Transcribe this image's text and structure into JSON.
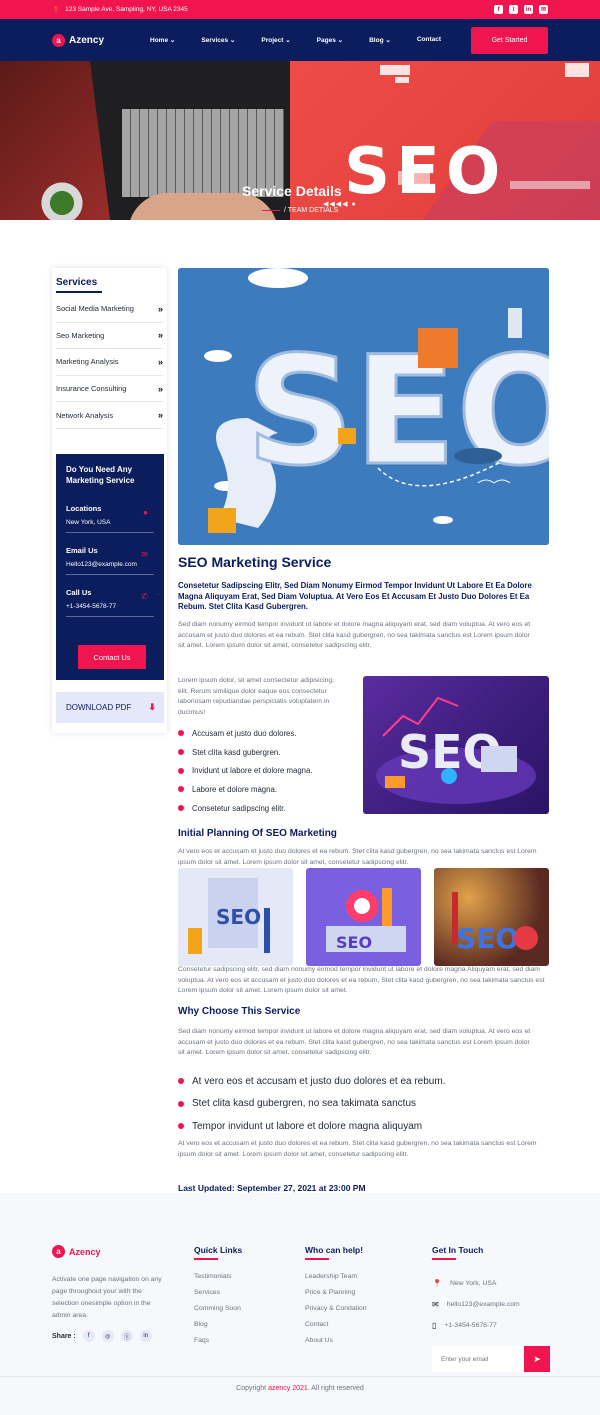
{
  "topbar": {
    "address": "123 Sample Ave, Sampling, NY, USA 2345"
  },
  "nav": {
    "logo": "Azency",
    "logo_mark": "a",
    "items": [
      "Home",
      "Services",
      "Project",
      "Pages",
      "Blog",
      "Contact"
    ],
    "cta": "Get Started"
  },
  "hero": {
    "title": "Service Details",
    "breadcrumb": "/ TEAM DETIALS",
    "seo_text": "SEO",
    "arrows": "◀◀◀◀ ●"
  },
  "sidebar": {
    "title": "Services",
    "items": [
      "Social Media Marketing",
      "Seo Marketing",
      "Marketing Analysis",
      "Insurance Consulting",
      "Network Analysis"
    ],
    "chevron": "»",
    "contact": {
      "title": "Do You Need Any Marketing Service",
      "locations_label": "Locations",
      "locations_value": "New York, USA",
      "email_label": "Email Us",
      "email_value": "Hello123@example.com",
      "call_label": "Call Us",
      "call_value": "+1-3454-5678-77",
      "button": "Contact Us"
    },
    "download": "DOWNLOAD PDF"
  },
  "main": {
    "seo_image_text": "SEO",
    "title": "SEO Marketing Service",
    "lead": "Consetetur Sadipscing Elitr, Sed Diam Nonumy Eirmod Tempor Invidunt Ut Labore Et Ea Dolore Magna Aliquyam Erat, Sed Diam Voluptua. At Vero Eos Et Accusam Et Justo Duo Dolores Et Ea Rebum. Stet Clita Kasd Gubergren.",
    "p1": "Sed diam nonumy eirmod tempor invidunt ut labore et dolore magna aliquyam erat, sed diam voluptua. At vero eos et accusam et justo duo dolores et ea rebum. Stet clita kasd gubergren, no sea takimata sanctus est Lorem ipsum dolor sit amet. Lorem ipsum dolor sit amet, consetetur sadipscing elitr.",
    "p2": "Lorem ipsum dolor, sit amet consectetur adipisicing, elit. Rerum similique dolor eaque eos consectetur laboriosam repudiandae perspiciatis voluptatem in ducimus!",
    "bullets": [
      "Accusam et justo duo dolores.",
      "Stet clita kasd gubergren.",
      "Invidunt ut labore et dolore magna.",
      "Labore et dolore magna.",
      "Consetetur sadipscing elitr."
    ],
    "h_planning": "Initial Planning Of SEO Marketing",
    "p3": "At vero eos et accusam et justo duo dolores et ea rebum. Stet clita kasd gubergren, no sea takimata sanctus est Lorem ipsum dolor sit amet. Lorem ipsum dolor sit amet, consetetur sadipscing elitr.",
    "p4": "Consetetur sadipscing elitr, sed diam nonumy eirmod tempor invidunt ut labore et dolore magna Aliquyam erat, sed diam voluptua. At vero eos et accusam et justo duo dolores et ea rebum, Stet clita kasd gubergren, no sea takimata sanctus est Lorem ipsum dolor sit amet. Lorem ipsum dolor sit amet.",
    "h_why": "Why Choose This Service",
    "p5": "Sed diam nonumy eirmod tempor invidunt ut labore et dolore magna aliquyam erat, sed diam voluptua. At vero eos et accusam et justo duo dolores et ea rebum. Stet clita kasd gubergren, no sea takimata sanctus est Lorem ipsum dolor sit amet. Lorem ipsum dolor sit amet, consetetur sadipscing elitr.",
    "why_bullets": [
      "At vero eos et accusam et justo duo dolores et ea rebum.",
      "Stet clita kasd gubergren, no sea takimata sanctus",
      "Tempor invidunt ut labore et dolore magna aliquyam"
    ],
    "p6": "At vero eos et accusam et justo duo dolores et ea rebum. Stet clita kasd gubergren, no sea takimata sanctus est Lorem ipsum dolor sit amet. Lorem ipsum dolor sit amet, consetetur sadipscing elitr.",
    "updated": "Last Updated: September 27, 2021 at 23:00 PM"
  },
  "footer": {
    "logo": "Azency",
    "about": "Activate one page navigation on any page throughout your with the selection onesimple option in the admin area.",
    "share": "Share :",
    "share_icons": [
      "f",
      "◎",
      "ⓢ",
      "in"
    ],
    "quick_title": "Quick Links",
    "quick": [
      "Testimonials",
      "Services",
      "Comming Soon",
      "Blog",
      "Faqs"
    ],
    "help_title": "Who can help!",
    "help": [
      "Leadership Team",
      "Price & Planning",
      "Privacy & Condation",
      "Contact",
      "About Us"
    ],
    "touch_title": "Get In Touch",
    "location": "New York, USA",
    "email": "hello123@example.com",
    "phone": "+1-3454-5678-77",
    "email_placeholder": "Enter your email",
    "copy_prefix": "Copyright ",
    "copy_brand": "azency 2021",
    "copy_suffix": ". All right reserved"
  }
}
